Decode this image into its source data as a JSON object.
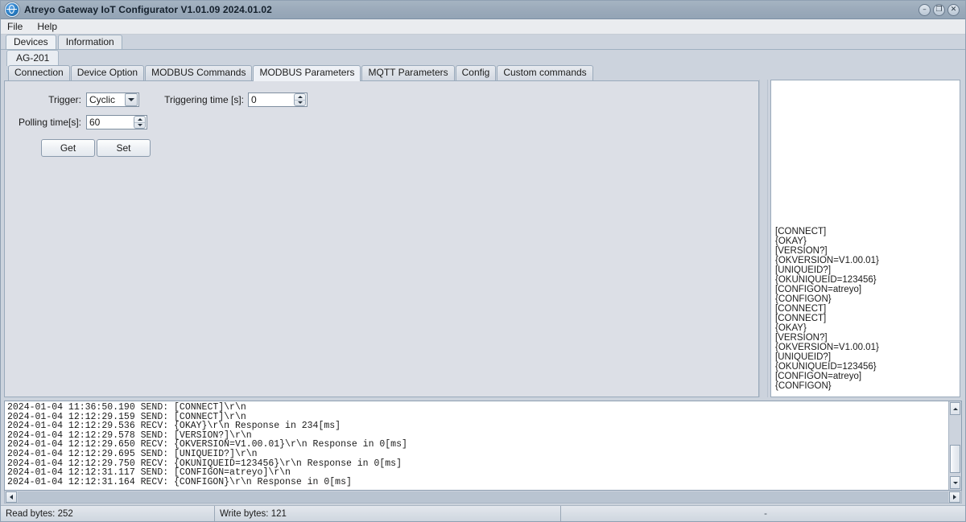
{
  "window": {
    "title": "Atreyo Gateway  IoT Configurator V1.01.09 2024.01.02",
    "icon": "globe-icon",
    "buttons": {
      "minimize": "–",
      "maximize": "❐",
      "close": "✕"
    }
  },
  "menubar": {
    "items": [
      {
        "label": "File"
      },
      {
        "label": "Help"
      }
    ]
  },
  "top_tabs": {
    "items": [
      {
        "label": "Devices",
        "active": true
      },
      {
        "label": "Information",
        "active": false
      }
    ]
  },
  "device_tabs": {
    "items": [
      {
        "label": "AG-201",
        "active": true
      }
    ]
  },
  "inner_tabs": {
    "items": [
      {
        "label": "Connection",
        "active": false
      },
      {
        "label": "Device Option",
        "active": false
      },
      {
        "label": "MODBUS Commands",
        "active": false
      },
      {
        "label": "MODBUS Parameters",
        "active": true
      },
      {
        "label": "MQTT Parameters",
        "active": false
      },
      {
        "label": "Config",
        "active": false
      },
      {
        "label": "Custom commands",
        "active": false
      }
    ]
  },
  "form": {
    "trigger": {
      "label": "Trigger:",
      "value": "Cyclic",
      "options": [
        "Cyclic"
      ]
    },
    "triggering_time": {
      "label": "Triggering time [s]:",
      "value": "0"
    },
    "polling_time": {
      "label": "Polling time[s]:",
      "value": "60"
    },
    "get_button": "Get",
    "set_button": "Set"
  },
  "side_log": {
    "lines": [
      "[CONNECT]",
      "{OKAY}",
      "[VERSION?]",
      "{OKVERSION=V1.00.01}",
      "[UNIQUEID?]",
      "{OKUNIQUEID=123456}",
      "[CONFIGON=atreyo]",
      "{CONFIGON}",
      "[CONNECT]",
      "[CONNECT]",
      "{OKAY}",
      "[VERSION?]",
      "{OKVERSION=V1.00.01}",
      "[UNIQUEID?]",
      "{OKUNIQUEID=123456}",
      "[CONFIGON=atreyo]",
      "{CONFIGON}"
    ]
  },
  "console_log": {
    "lines": [
      "2024-01-04 11:36:50.190 SEND: [CONNECT]\\r\\n",
      "2024-01-04 12:12:29.159 SEND: [CONNECT]\\r\\n",
      "2024-01-04 12:12:29.536 RECV: {OKAY}\\r\\n Response in 234[ms]",
      "2024-01-04 12:12:29.578 SEND: [VERSION?]\\r\\n",
      "2024-01-04 12:12:29.650 RECV: {OKVERSION=V1.00.01}\\r\\n Response in 0[ms]",
      "2024-01-04 12:12:29.695 SEND: [UNIQUEID?]\\r\\n",
      "2024-01-04 12:12:29.750 RECV: {OKUNIQUEID=123456}\\r\\n Response in 0[ms]",
      "2024-01-04 12:12:31.117 SEND: [CONFIGON=atreyo]\\r\\n",
      "2024-01-04 12:12:31.164 RECV: {CONFIGON}\\r\\n Response in 0[ms]"
    ]
  },
  "statusbar": {
    "read_bytes": "Read bytes: 252",
    "write_bytes": "Write bytes: 121",
    "extra": "-"
  },
  "colors": {
    "titlebar": "#9cabbb",
    "panel": "#dcdfe6",
    "chrome": "#ccd3dd",
    "text": "#1b1b1b"
  }
}
